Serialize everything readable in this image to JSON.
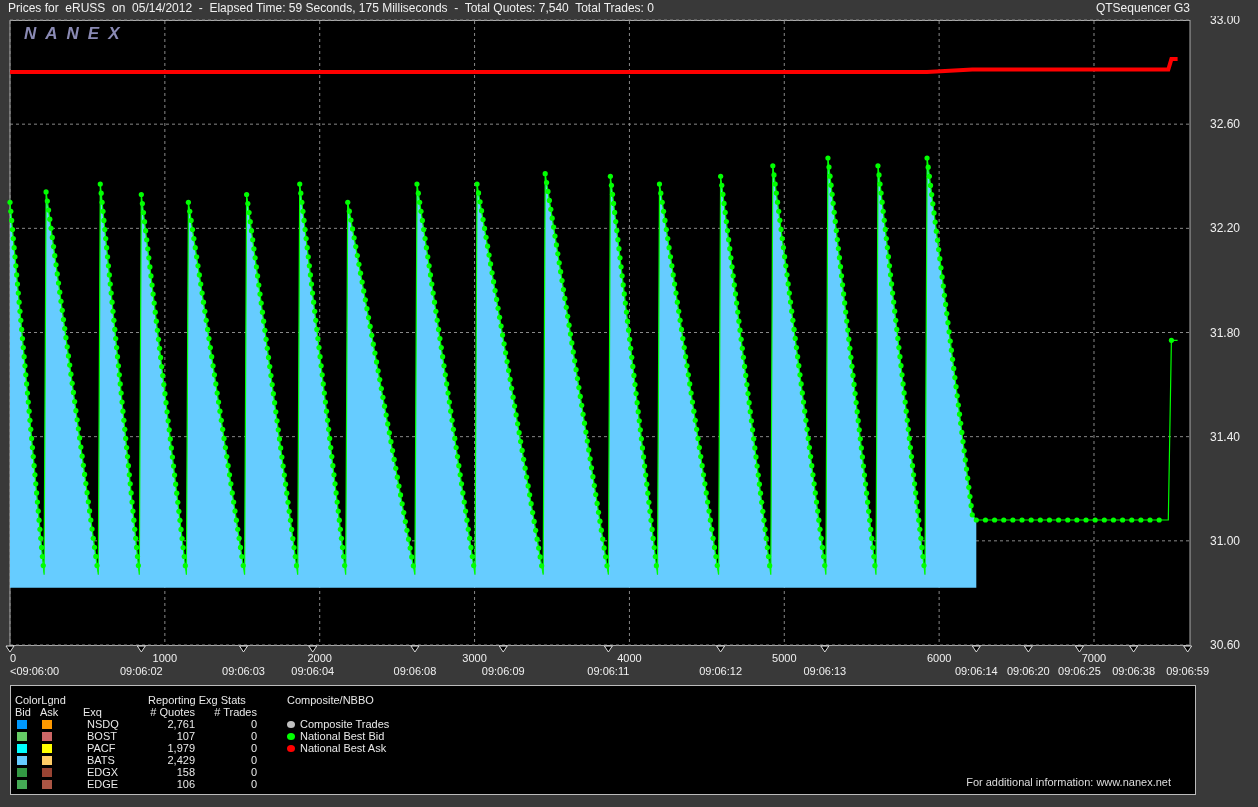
{
  "title_bar": {
    "title": "Prices for  eRUSS  on  05/14/2012  -  Elapsed Time: 59 Seconds, 175 Milliseconds  -  Total Quotes: 7,540  Total Trades: 0",
    "app_name": "QTSequencer G3"
  },
  "chart": {
    "logo": "NANEX",
    "chart_data": {
      "type": "line",
      "grid": true,
      "xlim": [
        0,
        7620
      ],
      "ylim": [
        30.6,
        33.0
      ],
      "x": [
        0,
        220,
        233,
        570,
        583,
        835,
        848,
        1139,
        1152,
        1515,
        1528,
        1858,
        1871,
        2168,
        2181,
        2615,
        2628,
        3003,
        3016,
        3443,
        3456,
        3864,
        3877,
        4181,
        4194,
        4576,
        4589,
        4913,
        4926,
        5269,
        5282,
        5592,
        5605,
        5909,
        5922,
        6214,
        6240,
        7480,
        7500,
        7540
      ],
      "series": [
        {
          "name": "National Best Bid",
          "color": "#00ff00",
          "values": [
            32.3,
            30.87,
            32.34,
            30.87,
            32.37,
            30.87,
            32.33,
            30.87,
            32.3,
            30.87,
            32.33,
            30.87,
            32.37,
            30.87,
            32.3,
            30.87,
            32.37,
            30.87,
            32.37,
            30.87,
            32.41,
            30.87,
            32.4,
            30.87,
            32.37,
            30.87,
            32.4,
            30.87,
            32.44,
            30.87,
            32.47,
            30.87,
            32.44,
            30.87,
            32.47,
            31.1,
            31.08,
            31.08,
            31.77,
            31.77
          ]
        },
        {
          "name": "National Best Ask",
          "color": "#ff0000",
          "values": [
            32.8,
            32.8,
            32.8,
            32.8,
            32.8,
            32.8,
            32.8,
            32.8,
            32.8,
            32.8,
            32.8,
            32.8,
            32.8,
            32.8,
            32.8,
            32.8,
            32.8,
            32.8,
            32.8,
            32.8,
            32.8,
            32.8,
            32.8,
            32.8,
            32.8,
            32.8,
            32.8,
            32.8,
            32.8,
            32.8,
            32.8,
            32.8,
            32.8,
            32.8,
            32.8,
            32.81,
            32.81,
            32.81,
            32.85,
            32.85
          ]
        }
      ],
      "xticks": [
        0,
        1000,
        2000,
        3000,
        4000,
        5000,
        6000,
        7000
      ],
      "yticks": [
        {
          "value": 33.0,
          "label": "33.00"
        },
        {
          "value": 32.6,
          "label": "32.60"
        },
        {
          "value": 32.2,
          "label": "32.20"
        },
        {
          "value": 31.8,
          "label": "31.80"
        },
        {
          "value": 31.4,
          "label": "31.40"
        },
        {
          "value": 31.0,
          "label": "31.00"
        },
        {
          "value": 30.6,
          "label": "30.60"
        }
      ],
      "annotations": [
        "<09:06:00",
        "09:06:02",
        "09:06:03",
        "09:06:04",
        "09:06:08",
        "09:06:09",
        "09:06:11",
        "09:06:12",
        "09:06:13",
        "09:06:14",
        "09:06:20",
        "09:06:25",
        "09:06:38",
        "09:06:59"
      ]
    }
  },
  "legend": {
    "color_legend_title": "ColorLgnd",
    "stats_title": "Reporting Exg Stats",
    "nbbo_title": "Composite/NBBO",
    "columns": [
      "Bid",
      "Ask",
      "Exq",
      "# Quotes",
      "# Trades"
    ],
    "exchanges": [
      {
        "name": "NSDQ",
        "bid": {
          "color": "#0099ff"
        },
        "ask": {
          "color": "#ff9900"
        },
        "quotes": "2,761",
        "trades": "0"
      },
      {
        "name": "BOST",
        "bid": {
          "color": "#66cc66"
        },
        "ask": {
          "color": "#cc6666"
        },
        "quotes": "107",
        "trades": "0"
      },
      {
        "name": "PACF",
        "bid": {
          "color": "#00ffff"
        },
        "ask": {
          "color": "#ffff00"
        },
        "quotes": "1,979",
        "trades": "0"
      },
      {
        "name": "BATS",
        "bid": {
          "color": "#66ccff"
        },
        "ask": {
          "color": "#ffcc66"
        },
        "quotes": "2,429",
        "trades": "0"
      },
      {
        "name": "EDGX",
        "bid": {
          "color": "#339944"
        },
        "ask": {
          "color": "#994433"
        },
        "quotes": "158",
        "trades": "0"
      },
      {
        "name": "EDGE",
        "bid": {
          "color": "#44aa55"
        },
        "ask": {
          "color": "#aa5544"
        },
        "quotes": "106",
        "trades": "0"
      }
    ],
    "nbbo_items": [
      {
        "label": "Composite Trades",
        "color": "#c0c0c0"
      }
    ],
    "footer": "For additional information: www.nanex.net"
  }
}
